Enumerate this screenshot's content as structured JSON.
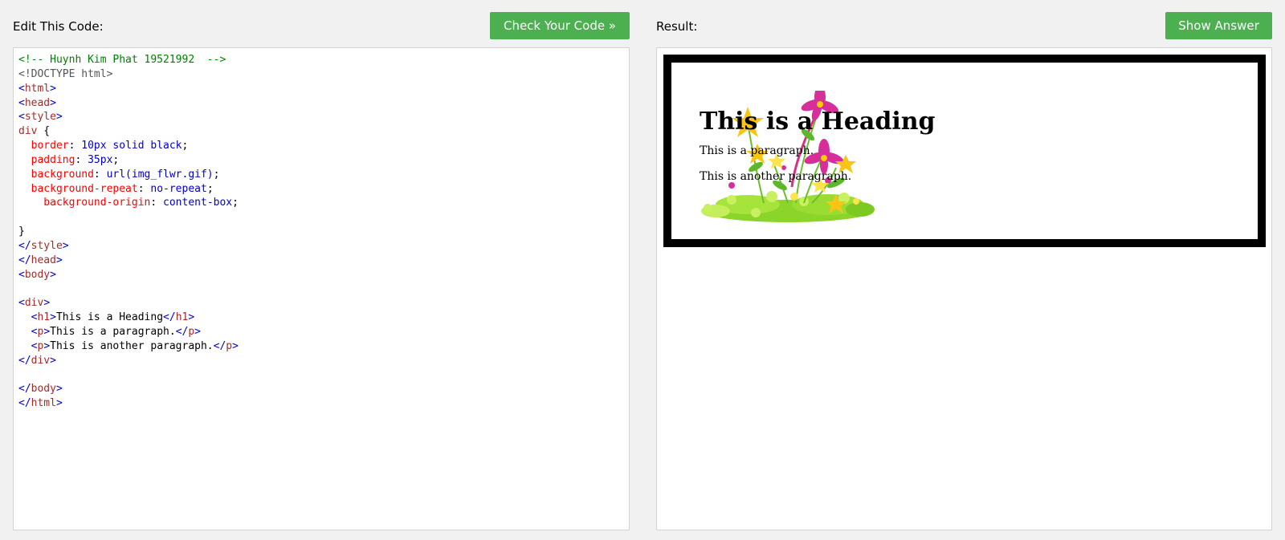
{
  "editor": {
    "label": "Edit This Code:",
    "check_button": "Check Your Code »",
    "code_lines": [
      [
        {
          "t": "<!-- Huynh Kim Phat 19521992  -->",
          "c": "cm"
        }
      ],
      [
        {
          "t": "<!DOCTYPE html>",
          "c": "dt"
        }
      ],
      [
        {
          "t": "<",
          "c": "br"
        },
        {
          "t": "html",
          "c": "tg"
        },
        {
          "t": ">",
          "c": "br"
        }
      ],
      [
        {
          "t": "<",
          "c": "br"
        },
        {
          "t": "head",
          "c": "tg"
        },
        {
          "t": ">",
          "c": "br"
        }
      ],
      [
        {
          "t": "<",
          "c": "br"
        },
        {
          "t": "style",
          "c": "tg"
        },
        {
          "t": ">",
          "c": "br"
        }
      ],
      [
        {
          "t": "div",
          "c": "tg"
        },
        {
          "t": " {",
          "c": ""
        }
      ],
      [
        {
          "t": "  border",
          "c": "at"
        },
        {
          "t": ": ",
          "c": ""
        },
        {
          "t": "10px solid black",
          "c": "vl"
        },
        {
          "t": ";",
          "c": ""
        }
      ],
      [
        {
          "t": "  padding",
          "c": "at"
        },
        {
          "t": ": ",
          "c": ""
        },
        {
          "t": "35px",
          "c": "vl"
        },
        {
          "t": ";",
          "c": ""
        }
      ],
      [
        {
          "t": "  background",
          "c": "at"
        },
        {
          "t": ": ",
          "c": ""
        },
        {
          "t": "url(img_flwr.gif)",
          "c": "vl"
        },
        {
          "t": ";",
          "c": ""
        }
      ],
      [
        {
          "t": "  background-repeat",
          "c": "at"
        },
        {
          "t": ": ",
          "c": ""
        },
        {
          "t": "no-repeat",
          "c": "vl"
        },
        {
          "t": ";",
          "c": ""
        }
      ],
      [
        {
          "t": "    background-origin",
          "c": "at"
        },
        {
          "t": ": ",
          "c": ""
        },
        {
          "t": "content-box",
          "c": "vl"
        },
        {
          "t": ";",
          "c": ""
        }
      ],
      [],
      [
        {
          "t": "}",
          "c": ""
        }
      ],
      [
        {
          "t": "</",
          "c": "br"
        },
        {
          "t": "style",
          "c": "tg"
        },
        {
          "t": ">",
          "c": "br"
        }
      ],
      [
        {
          "t": "</",
          "c": "br"
        },
        {
          "t": "head",
          "c": "tg"
        },
        {
          "t": ">",
          "c": "br"
        }
      ],
      [
        {
          "t": "<",
          "c": "br"
        },
        {
          "t": "body",
          "c": "tg"
        },
        {
          "t": ">",
          "c": "br"
        }
      ],
      [],
      [
        {
          "t": "<",
          "c": "br"
        },
        {
          "t": "div",
          "c": "tg"
        },
        {
          "t": ">",
          "c": "br"
        }
      ],
      [
        {
          "t": "  <",
          "c": "br"
        },
        {
          "t": "h1",
          "c": "tg"
        },
        {
          "t": ">",
          "c": "br"
        },
        {
          "t": "This is a Heading",
          "c": ""
        },
        {
          "t": "</",
          "c": "br"
        },
        {
          "t": "h1",
          "c": "tg"
        },
        {
          "t": ">",
          "c": "br"
        }
      ],
      [
        {
          "t": "  <",
          "c": "br"
        },
        {
          "t": "p",
          "c": "tg"
        },
        {
          "t": ">",
          "c": "br"
        },
        {
          "t": "This is a paragraph.",
          "c": ""
        },
        {
          "t": "</",
          "c": "br"
        },
        {
          "t": "p",
          "c": "tg"
        },
        {
          "t": ">",
          "c": "br"
        }
      ],
      [
        {
          "t": "  <",
          "c": "br"
        },
        {
          "t": "p",
          "c": "tg"
        },
        {
          "t": ">",
          "c": "br"
        },
        {
          "t": "This is another paragraph.",
          "c": ""
        },
        {
          "t": "</",
          "c": "br"
        },
        {
          "t": "p",
          "c": "tg"
        },
        {
          "t": ">",
          "c": "br"
        }
      ],
      [
        {
          "t": "</",
          "c": "br"
        },
        {
          "t": "div",
          "c": "tg"
        },
        {
          "t": ">",
          "c": "br"
        }
      ],
      [],
      [
        {
          "t": "</",
          "c": "br"
        },
        {
          "t": "body",
          "c": "tg"
        },
        {
          "t": ">",
          "c": "br"
        }
      ],
      [
        {
          "t": "</",
          "c": "br"
        },
        {
          "t": "html",
          "c": "tg"
        },
        {
          "t": ">",
          "c": "br"
        }
      ]
    ]
  },
  "result": {
    "label": "Result:",
    "show_answer_button": "Show Answer",
    "heading": "This is a Heading",
    "paragraph_1": "This is a paragraph.",
    "paragraph_2": "This is another paragraph."
  },
  "colors": {
    "button_green": "#4caf50",
    "page_background": "#f1f1f1",
    "panel_border": "#d3d3d3"
  },
  "icons": {
    "result_background_image": "flower-bouquet-image"
  }
}
